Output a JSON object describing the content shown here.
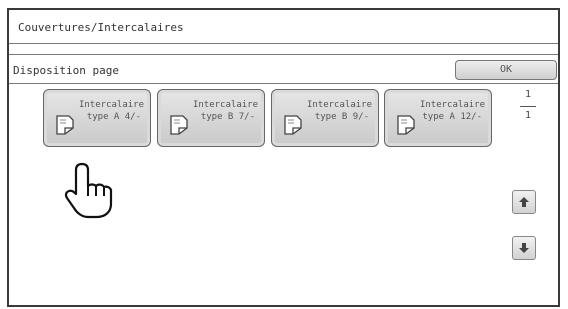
{
  "window": {
    "title": "Couvertures/Intercalaires"
  },
  "panel": {
    "title": "Disposition page",
    "ok_label": "OK"
  },
  "tiles": [
    {
      "line1": "Intercalaire",
      "line2": "type A 4/-",
      "icon": "page-insert-icon"
    },
    {
      "line1": "Intercalaire",
      "line2": "type B 7/-",
      "icon": "page-insert-icon"
    },
    {
      "line1": "Intercalaire",
      "line2": "type B 9/-",
      "icon": "page-insert-icon"
    },
    {
      "line1": "Intercalaire",
      "line2": "type A 12/-",
      "icon": "page-insert-icon"
    }
  ],
  "pagination": {
    "current": "1",
    "total": "1"
  },
  "icons": {
    "scroll_up": "arrow-up-icon",
    "scroll_down": "arrow-down-icon",
    "pointer": "hand-pointer-icon"
  }
}
